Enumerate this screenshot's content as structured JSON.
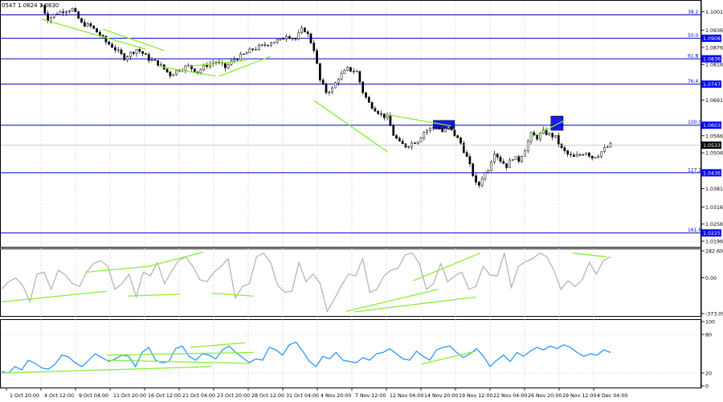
{
  "header": {
    "text": "0547 1.0824 1.0830"
  },
  "colors": {
    "candle": "#000000",
    "fib_line": "#0000cc",
    "fib_box": "#0000ff",
    "fib_box_text": "#ffffff",
    "current_box": "#000000",
    "trend_line": "#88ee33",
    "cci_line": "#b0b0b0",
    "rsi_line": "#1e90ff",
    "grid": "#c8c8c8",
    "blue_zone": "#1a1aee"
  },
  "chart_data": [
    {
      "type": "candlestick",
      "symbol": "EUR/USD 4H",
      "ylim": [
        1.0196,
        1.1031
      ],
      "price_ticks": [
        "1.1001",
        "1.0936",
        "1.0876",
        "1.0816",
        "1.0691",
        "1.0566",
        "1.0506",
        "1.0381",
        "1.0316",
        "1.0256",
        "1.0196"
      ],
      "time_labels": [
        "1 Oct 20:00",
        "4 Oct 12:00",
        "9 Oct 04:00",
        "11 Oct 20:00",
        "16 Oct 12:00",
        "21 Oct 04:00",
        "23 Oct 20:00",
        "28 Oct 12:00",
        "31 Oct 04:00",
        "4 Nov 20:00",
        "7 Nov 12:00",
        "12 Nov 04:00",
        "14 Nov 20:00",
        "19 Nov 12:00",
        "22 Nov 04:00",
        "26 Nov 20:00",
        "29 Nov 12:00",
        "4 Dec 04:00"
      ],
      "path": [
        [
          0,
          1.1024
        ],
        [
          4,
          1.0975
        ],
        [
          8,
          1.099
        ],
        [
          14,
          1.1005
        ],
        [
          20,
          1.101
        ],
        [
          26,
          1.096
        ],
        [
          32,
          1.095
        ],
        [
          38,
          1.092
        ],
        [
          42,
          1.0895
        ],
        [
          46,
          1.088
        ],
        [
          50,
          1.086
        ],
        [
          54,
          1.084
        ],
        [
          58,
          1.0855
        ],
        [
          62,
          1.087
        ],
        [
          66,
          1.0855
        ],
        [
          70,
          1.0835
        ],
        [
          76,
          1.082
        ],
        [
          80,
          1.08
        ],
        [
          84,
          1.078
        ],
        [
          90,
          1.08
        ],
        [
          96,
          1.081
        ],
        [
          102,
          1.079
        ],
        [
          108,
          1.0815
        ],
        [
          114,
          1.0825
        ],
        [
          120,
          1.0805
        ],
        [
          126,
          1.0835
        ],
        [
          132,
          1.085
        ],
        [
          138,
          1.087
        ],
        [
          144,
          1.088
        ],
        [
          150,
          1.0895
        ],
        [
          156,
          1.09
        ],
        [
          160,
          1.092
        ],
        [
          166,
          1.0905
        ],
        [
          171,
          1.0945
        ],
        [
          174,
          1.092
        ],
        [
          178,
          1.087
        ],
        [
          182,
          1.076
        ],
        [
          186,
          1.072
        ],
        [
          190,
          1.073
        ],
        [
          194,
          1.077
        ],
        [
          200,
          1.08
        ],
        [
          206,
          1.079
        ],
        [
          210,
          1.072
        ],
        [
          214,
          1.068
        ],
        [
          218,
          1.066
        ],
        [
          222,
          1.064
        ],
        [
          226,
          1.063
        ],
        [
          230,
          1.057
        ],
        [
          234,
          1.054
        ],
        [
          238,
          1.053
        ],
        [
          242,
          1.054
        ],
        [
          246,
          1.055
        ],
        [
          250,
          1.058
        ],
        [
          254,
          1.059
        ],
        [
          258,
          1.06
        ],
        [
          262,
          1.058
        ],
        [
          266,
          1.0595
        ],
        [
          270,
          1.057
        ],
        [
          274,
          1.054
        ],
        [
          278,
          1.049
        ],
        [
          282,
          1.043
        ],
        [
          285,
          1.038
        ],
        [
          288,
          1.042
        ],
        [
          292,
          1.045
        ],
        [
          296,
          1.051
        ],
        [
          300,
          1.048
        ],
        [
          304,
          1.046
        ],
        [
          308,
          1.049
        ],
        [
          312,
          1.048
        ],
        [
          316,
          1.052
        ],
        [
          320,
          1.057
        ],
        [
          324,
          1.056
        ],
        [
          328,
          1.058
        ],
        [
          332,
          1.057
        ],
        [
          336,
          1.056
        ],
        [
          340,
          1.052
        ],
        [
          344,
          1.05
        ],
        [
          348,
          1.049
        ],
        [
          352,
          1.05
        ],
        [
          356,
          1.051
        ],
        [
          360,
          1.049
        ],
        [
          364,
          1.05
        ],
        [
          368,
          1.052
        ],
        [
          372,
          1.0533
        ]
      ],
      "fib_levels": [
        {
          "label": "38.2",
          "price": 1.099,
          "tag": ""
        },
        {
          "label": "50.0",
          "price": 1.0908,
          "tag": "1.0908"
        },
        {
          "label": "61.8",
          "price": 1.0836,
          "tag": "1.0836"
        },
        {
          "label": "76.4",
          "price": 1.0747,
          "tag": "1.0747"
        },
        {
          "label": "100.0",
          "price": 1.0603,
          "tag": "1.0603"
        },
        {
          "label": "127.2",
          "price": 1.0436,
          "tag": "1.0436"
        },
        {
          "label": "161.8",
          "price": 1.0225,
          "tag": "1.0225"
        }
      ],
      "current_price": {
        "value": 1.0533,
        "label": "1.0533"
      },
      "blue_zones": [
        {
          "x0": 256,
          "x1": 270,
          "p0": 1.059,
          "p1": 1.062
        },
        {
          "x0": 333,
          "x1": 341,
          "p0": 1.0585,
          "p1": 1.0635
        }
      ],
      "trendlines": [
        [
          [
            0,
            1.0975
          ],
          [
            68,
            1.087
          ]
        ],
        [
          [
            40,
            1.094
          ],
          [
            80,
            1.0865
          ]
        ],
        [
          [
            76,
            1.081
          ],
          [
            114,
            1.0775
          ]
        ],
        [
          [
            96,
            1.081
          ],
          [
            134,
            1.083
          ]
        ],
        [
          [
            116,
            1.0775
          ],
          [
            150,
            1.0845
          ]
        ],
        [
          [
            178,
            1.069
          ],
          [
            226,
            1.051
          ]
        ],
        [
          [
            226,
            1.064
          ],
          [
            268,
            1.06
          ]
        ],
        [
          [
            320,
            1.056
          ],
          [
            342,
            1.062
          ]
        ]
      ]
    },
    {
      "type": "line",
      "series": [
        {
          "name": "CCI",
          "values": [
            -120,
            -40,
            0,
            -80,
            -250,
            40,
            60,
            -120,
            80,
            30,
            -60,
            -90,
            60,
            150,
            180,
            120,
            -120,
            -60,
            40,
            -200,
            60,
            20,
            160,
            -60,
            70,
            180,
            220,
            120,
            -20,
            -40,
            60,
            120,
            200,
            -210,
            -90,
            -60,
            220,
            260,
            160,
            -80,
            -150,
            -140,
            160,
            -40,
            40,
            -60,
            -350,
            -220,
            -80,
            40,
            20,
            200,
            -150,
            -120,
            20,
            80,
            100,
            240,
            260,
            150,
            -120,
            -60,
            150,
            -40,
            20,
            60,
            -120,
            -90,
            120,
            30,
            20,
            260,
            -100,
            120,
            170,
            200,
            260,
            220,
            80,
            -120,
            -30,
            -90,
            -20,
            160,
            40,
            180,
            220
          ]
        }
      ],
      "ylim": [
        -373.097,
        282.6012
      ],
      "ticks": [
        "282.6012",
        "0.00",
        "-373.097"
      ],
      "trendlines": [
        [
          [
            0,
            -250
          ],
          [
            50,
            -140
          ]
        ],
        [
          [
            40,
            60
          ],
          [
            70,
            120
          ]
        ],
        [
          [
            60,
            -190
          ],
          [
            85,
            -170
          ]
        ],
        [
          [
            70,
            120
          ],
          [
            96,
            270
          ]
        ],
        [
          [
            100,
            -160
          ],
          [
            120,
            -190
          ]
        ],
        [
          [
            164,
            -350
          ],
          [
            208,
            -120
          ]
        ],
        [
          [
            168,
            -355
          ],
          [
            226,
            -200
          ]
        ],
        [
          [
            196,
            -30
          ],
          [
            228,
            260
          ]
        ],
        [
          [
            272,
            260
          ],
          [
            288,
            220
          ]
        ]
      ]
    },
    {
      "type": "line",
      "series": [
        {
          "name": "RSI",
          "values": [
            22,
            20,
            30,
            25,
            40,
            35,
            28,
            26,
            34,
            48,
            45,
            36,
            30,
            40,
            50,
            44,
            38,
            42,
            48,
            46,
            30,
            52,
            60,
            40,
            36,
            38,
            58,
            62,
            46,
            40,
            50,
            48,
            42,
            56,
            62,
            52,
            44,
            36,
            42,
            40,
            60,
            56,
            48,
            64,
            68,
            54,
            38,
            30,
            46,
            42,
            52,
            40,
            38,
            36,
            44,
            40,
            50,
            52,
            58,
            50,
            42,
            40,
            54,
            46,
            40,
            56,
            60,
            62,
            52,
            44,
            50,
            58,
            46,
            30,
            40,
            48,
            38,
            52,
            46,
            54,
            60,
            56,
            62,
            58,
            64,
            60,
            52,
            46,
            50,
            48,
            56,
            52
          ]
        }
      ],
      "ylim": [
        0,
        100
      ],
      "ticks": [
        "100",
        "80",
        "20",
        "0"
      ],
      "trendlines": [
        [
          [
            0,
            20
          ],
          [
            100,
            30
          ]
        ],
        [
          [
            50,
            40
          ],
          [
            118,
            35
          ]
        ],
        [
          [
            50,
            48
          ],
          [
            120,
            52
          ]
        ],
        [
          [
            90,
            60
          ],
          [
            116,
            67
          ]
        ],
        [
          [
            200,
            34
          ],
          [
            226,
            54
          ]
        ]
      ]
    }
  ]
}
